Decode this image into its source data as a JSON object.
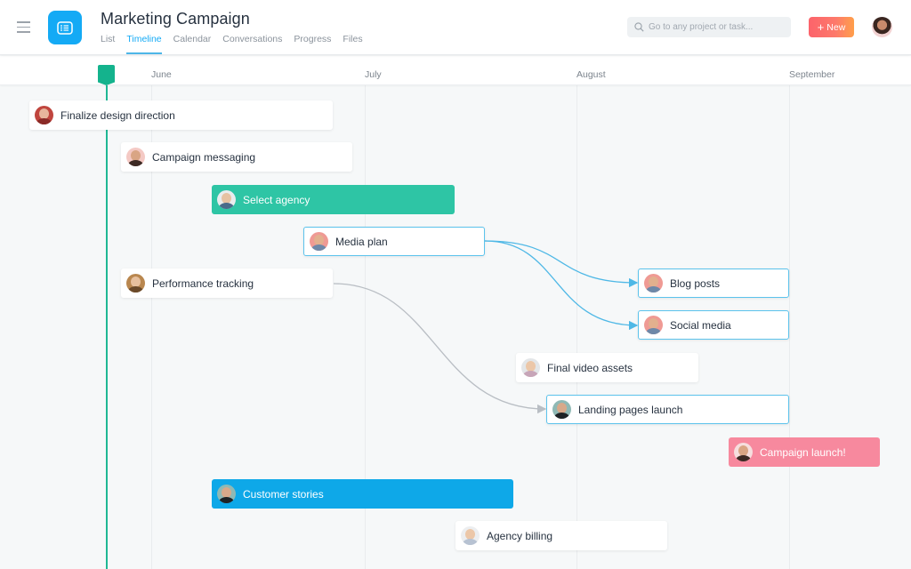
{
  "header": {
    "menu_icon": "hamburger-menu-icon",
    "app_icon": "project-list-icon",
    "title": "Marketing Campaign",
    "tabs": [
      {
        "label": "List",
        "active": false
      },
      {
        "label": "Timeline",
        "active": true
      },
      {
        "label": "Calendar",
        "active": false
      },
      {
        "label": "Conversations",
        "active": false
      },
      {
        "label": "Progress",
        "active": false
      },
      {
        "label": "Files",
        "active": false
      }
    ],
    "search_placeholder": "Go to any project or task...",
    "new_button": {
      "icon": "+",
      "label": "New"
    },
    "accent_color": "#14aaf5"
  },
  "timeline": {
    "months": [
      "June",
      "July",
      "August",
      "September"
    ],
    "today_marker_color": "#14b38d",
    "tasks": [
      {
        "name": "Finalize design direction",
        "style": "default"
      },
      {
        "name": "Campaign messaging",
        "style": "default"
      },
      {
        "name": "Select agency",
        "style": "green",
        "color": "#2ec5a5"
      },
      {
        "name": "Media plan",
        "style": "outlined"
      },
      {
        "name": "Performance tracking",
        "style": "default"
      },
      {
        "name": "Blog posts",
        "style": "outlined"
      },
      {
        "name": "Social media",
        "style": "outlined"
      },
      {
        "name": "Final video assets",
        "style": "default"
      },
      {
        "name": "Landing pages launch",
        "style": "outlined"
      },
      {
        "name": "Campaign launch!",
        "style": "pink",
        "color": "#f7899e"
      },
      {
        "name": "Customer stories",
        "style": "blue",
        "color": "#0ea8e8"
      },
      {
        "name": "Agency billing",
        "style": "default"
      }
    ],
    "dependencies": [
      {
        "from": "Media plan",
        "to": "Blog posts",
        "color": "#4fb8e6"
      },
      {
        "from": "Media plan",
        "to": "Social media",
        "color": "#4fb8e6"
      },
      {
        "from": "Performance tracking",
        "to": "Landing pages launch",
        "color": "#b9bec4"
      }
    ]
  }
}
